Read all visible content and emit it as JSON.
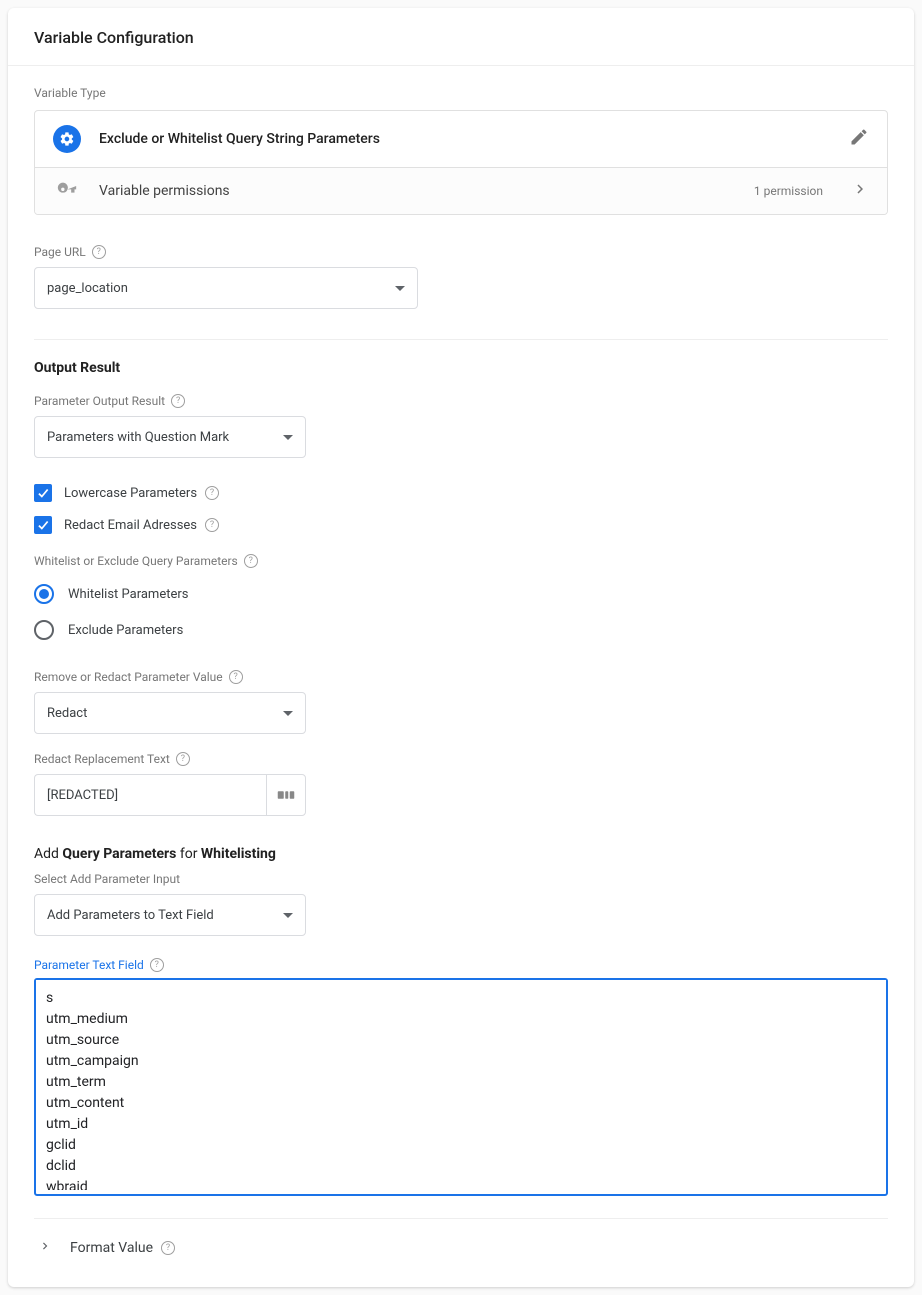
{
  "header": {
    "title": "Variable Configuration"
  },
  "variableType": {
    "label": "Variable Type",
    "name": "Exclude or Whitelist Query String Parameters",
    "permissions": {
      "label": "Variable permissions",
      "count": "1 permission"
    }
  },
  "pageUrl": {
    "label": "Page URL",
    "value": "page_location"
  },
  "output": {
    "title": "Output Result",
    "paramOutput": {
      "label": "Parameter Output Result",
      "value": "Parameters with Question Mark"
    },
    "lowercase": {
      "label": "Lowercase Parameters"
    },
    "redactEmail": {
      "label": "Redact Email Adresses"
    },
    "whitelistExclude": {
      "label": "Whitelist or Exclude Query Parameters",
      "whitelist": "Whitelist Parameters",
      "exclude": "Exclude Parameters"
    },
    "removeRedact": {
      "label": "Remove or Redact Parameter Value",
      "value": "Redact"
    },
    "redactText": {
      "label": "Redact Replacement Text",
      "value": "[REDACTED]"
    }
  },
  "addParams": {
    "title_prefix": "Add ",
    "title_bold1": "Query Parameters",
    "title_mid": " for ",
    "title_bold2": "Whitelisting",
    "selectInput": {
      "label": "Select Add Parameter Input",
      "value": "Add Parameters to Text Field"
    },
    "textField": {
      "label": "Parameter Text Field",
      "value": "s\nutm_medium\nutm_source\nutm_campaign\nutm_term\nutm_content\nutm_id\ngclid\ndclid\nwbraid\ngbraid"
    }
  },
  "formatValue": {
    "label": "Format Value"
  }
}
